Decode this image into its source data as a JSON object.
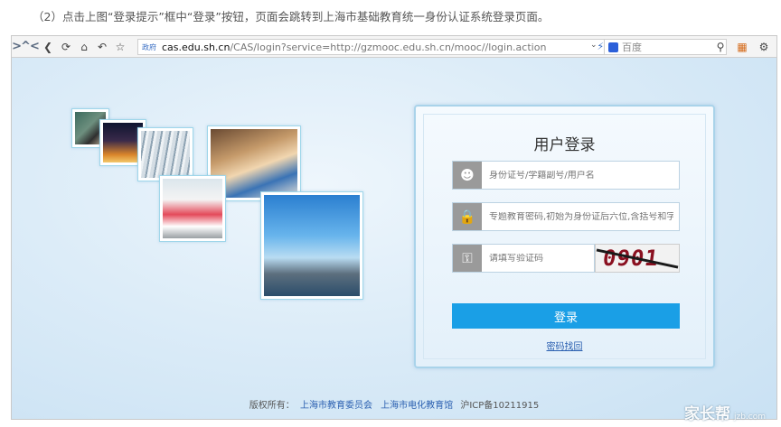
{
  "caption": "（2）点击上图“登录提示”框中“登录”按钮，页面会跳转到上海市基础教育统一身份认证系统登录页面。",
  "browser": {
    "address_badge": "政府",
    "address_host": "cas.edu.sh.cn",
    "address_path": "/CAS/login?service=http://gzmooc.edu.sh.cn/mooc//login.action",
    "search_placeholder": "百度"
  },
  "login": {
    "title": "用户登录",
    "username_placeholder": "身份证号/学籍副号/用户名",
    "password_placeholder": "专题教育密码,初始为身份证后六位,含括号和字",
    "captcha_placeholder": "请填写验证码",
    "captcha_text": "0901",
    "submit_label": "登录",
    "forgot_label": "密码找回"
  },
  "footer": {
    "copyright_label": "版权所有：",
    "org1": "上海市教育委员会",
    "org2": "上海市电化教育馆",
    "icp": "沪ICP备10211915"
  },
  "watermark": {
    "brand": "家长帮",
    "site": "jzb.com"
  },
  "colors": {
    "accent": "#1a9fe6",
    "link": "#2a5fb0"
  }
}
